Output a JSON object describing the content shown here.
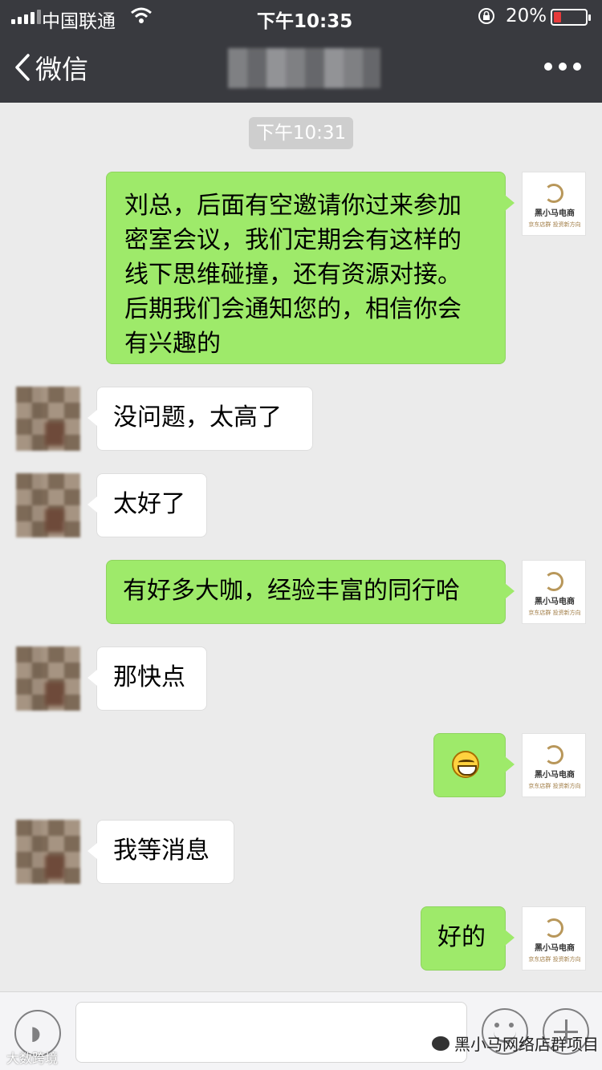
{
  "status_bar": {
    "carrier": "中国联通",
    "time": "下午10:35",
    "battery_percent": "20%"
  },
  "nav": {
    "back_label": "微信"
  },
  "chat": {
    "timestamp": "下午10:31",
    "messages": [
      {
        "side": "out",
        "text": "刘总，后面有空邀请你过来参加\n密室会议，我们定期会有这样的\n线下思维碰撞，还有资源对接。\n后期我们会通知您的，相信你会\n有兴趣的"
      },
      {
        "side": "in",
        "text": "没问题，太高了"
      },
      {
        "side": "in",
        "text": "太好了"
      },
      {
        "side": "out",
        "text": "有好多大咖，经验丰富的同行哈"
      },
      {
        "side": "in",
        "text": "那快点"
      },
      {
        "side": "out",
        "text": "",
        "emoji": "grinning-face"
      },
      {
        "side": "in",
        "text": "我等消息"
      },
      {
        "side": "out",
        "text": "好的"
      }
    ],
    "logo_name": "黑小马电商",
    "logo_sub": "京东店群 投资新方向"
  },
  "watermarks": {
    "left": "大数跨境",
    "right": "黑小马网络店群项目"
  },
  "colors": {
    "header_bg": "#393a3f",
    "chat_bg": "#ebebeb",
    "outgoing_bubble": "#9eea6a",
    "incoming_bubble": "#ffffff",
    "battery_low": "#e63a3a"
  }
}
